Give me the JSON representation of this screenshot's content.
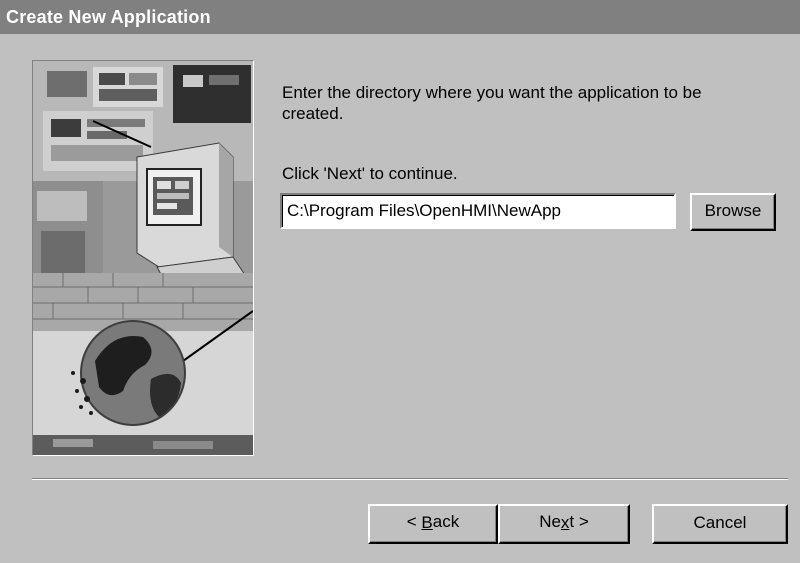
{
  "window": {
    "title": "Create New Application"
  },
  "content": {
    "instruction": "Enter the directory where you want the application to be created.",
    "continue_hint": "Click 'Next' to continue.",
    "directory_value": "C:\\Program Files\\OpenHMI\\NewApp"
  },
  "buttons": {
    "browse": "Browse",
    "back_prefix": "< ",
    "back_accel": "B",
    "back_rest": "ack",
    "next_prefix": "Ne",
    "next_accel": "x",
    "next_rest": "t >",
    "cancel": "Cancel"
  },
  "colors": {
    "dialog_bg": "#c0c0c0",
    "titlebar_bg": "#808080",
    "title_text": "#ffffff"
  },
  "icons": {
    "illustration": "wizard-illustration-computer-globe"
  }
}
